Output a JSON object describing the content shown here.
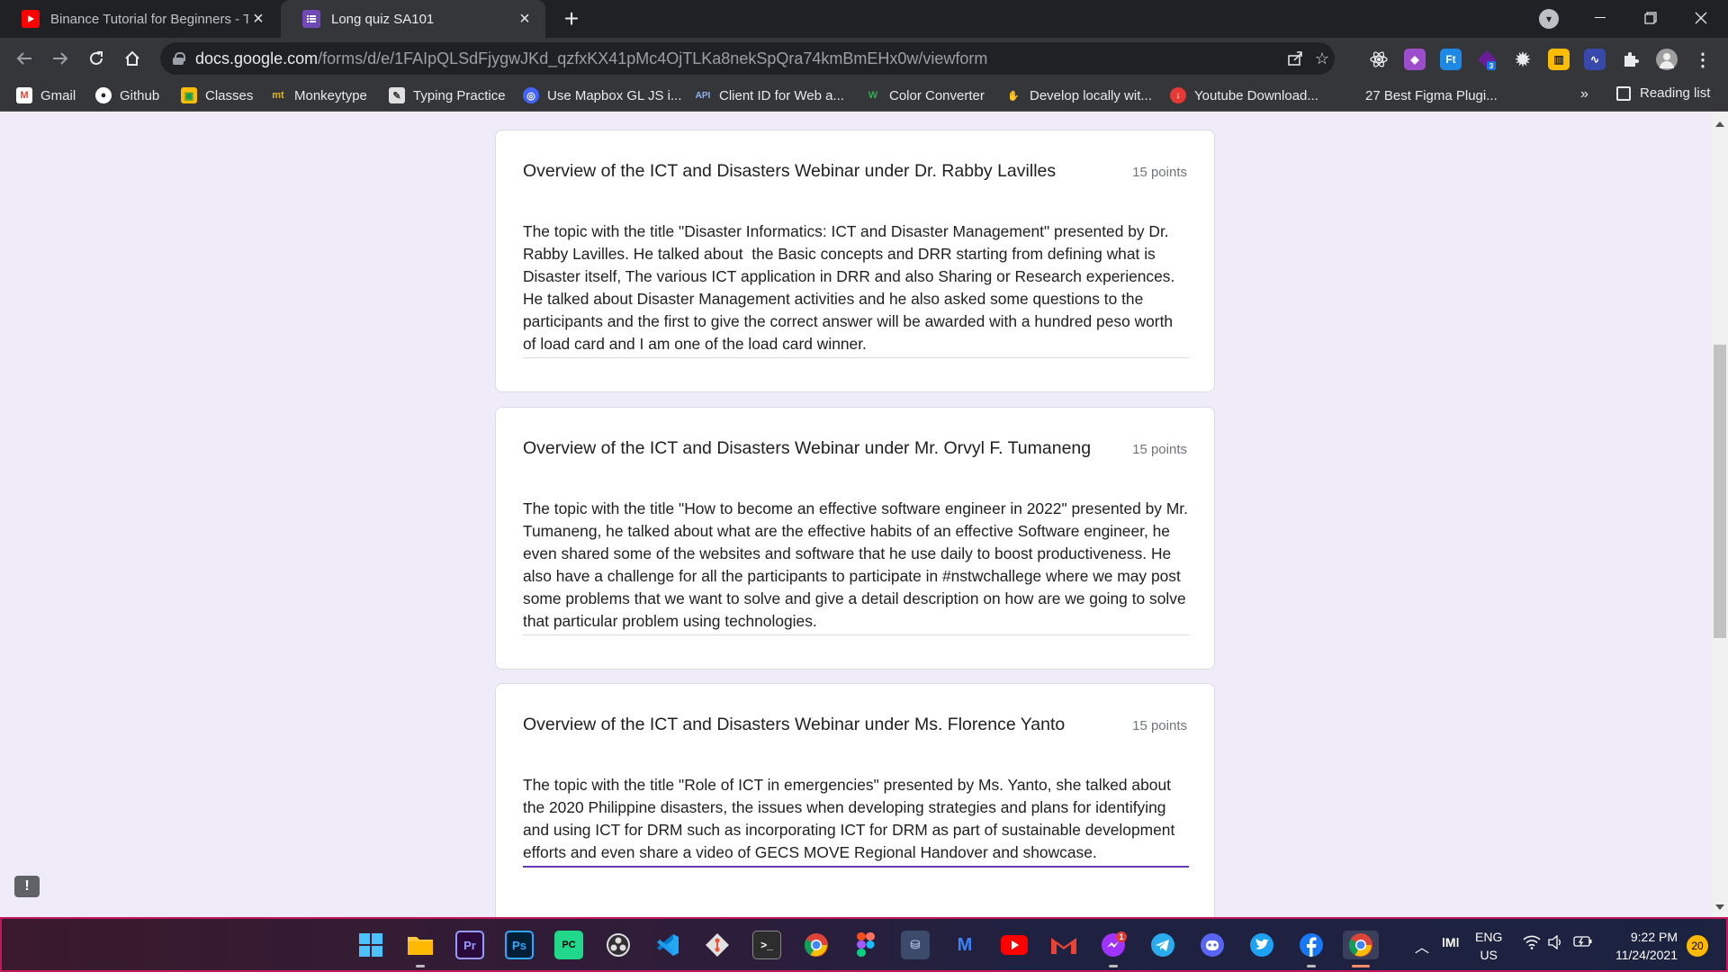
{
  "browser": {
    "tabs": [
      {
        "title": "Binance Tutorial for Beginners - T",
        "icon": "youtube-icon",
        "active": false
      },
      {
        "title": "Long quiz SA101",
        "icon": "google-forms-icon",
        "active": true
      }
    ],
    "new_tab_label": "+",
    "url_host": "docs.google.com",
    "url_path": "/forms/d/e/1FAIpQLSdFjygwJKd_qzfxKX41pMc4OjTLKa8nekSpQra74kmBmEHx0w/viewform",
    "extension_badge": "3"
  },
  "bookmarks": [
    {
      "label": "Gmail",
      "icon": "gmail-icon"
    },
    {
      "label": "Github",
      "icon": "github-icon"
    },
    {
      "label": "Classes",
      "icon": "classroom-icon"
    },
    {
      "label": "Monkeytype",
      "icon": "monkeytype-icon"
    },
    {
      "label": "Typing Practice",
      "icon": "typing-icon"
    },
    {
      "label": "Use Mapbox GL JS i...",
      "icon": "mapbox-icon"
    },
    {
      "label": "Client ID for Web a...",
      "icon": "api-icon"
    },
    {
      "label": "Color Converter",
      "icon": "color-converter-icon"
    },
    {
      "label": "Develop locally wit...",
      "icon": "develop-icon"
    },
    {
      "label": "Youtube Download...",
      "icon": "download-icon"
    },
    {
      "label": "27 Best Figma Plugi...",
      "icon": "figma-plugin-icon"
    }
  ],
  "bookmarks_more": "»",
  "reading_list": "Reading list",
  "form": {
    "questions": [
      {
        "title": "Overview of the ICT and Disasters Webinar under Dr. Rabby Lavilles",
        "points": "15 points",
        "answer": "The topic with the title \"Disaster Informatics: ICT and Disaster Management\" presented by Dr. Rabby Lavilles. He talked about  the Basic concepts and DRR starting from defining what is Disaster itself, The various ICT application in DRR and also Sharing or Research experiences. He talked about Disaster Management activities and he also asked some questions to the participants and the first to give the correct answer will be awarded with a hundred peso worth of load card and I am one of the load card winner."
      },
      {
        "title": "Overview of the ICT and Disasters Webinar under Mr. Orvyl F. Tumaneng",
        "points": "15 points",
        "answer": "The topic with the title \"How to become an effective software engineer in 2022\" presented by Mr. Tumaneng, he talked about what are the effective habits of an effective Software engineer, he even shared some of the websites and software that he use daily to boost productiveness. He also have a challenge for all the participants to participate in #nstwchallege where we may post some problems that we want to solve and give a detail description on how are we going to solve that particular problem using technologies."
      },
      {
        "title": "Overview of the ICT and Disasters Webinar under Ms. Florence Yanto",
        "points": "15 points",
        "answer": "The topic with the title \"Role of ICT in emergencies\" presented by Ms. Yanto, she talked about the 2020 Philippine disasters, the issues when developing strategies and plans for identifying and using ICT for DRM such as incorporating ICT for DRM as part of sustainable development efforts and even share a video of GECS MOVE Regional Handover and showcase."
      }
    ]
  },
  "feedback_icon": "!",
  "taskbar": {
    "messenger_badge": "1",
    "lang_line1": "ENG",
    "lang_line2": "US",
    "time": "9:22 PM",
    "date": "11/24/2021",
    "notification_count": "20"
  }
}
